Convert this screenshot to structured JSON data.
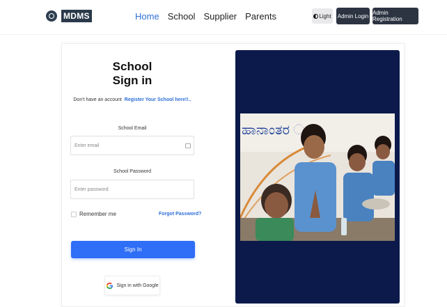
{
  "nav": {
    "brand": "MDMS",
    "links": [
      "Home",
      "School",
      "Supplier",
      "Parents"
    ],
    "active": "Home",
    "theme_label": "Light",
    "admin_login": "Admin Login",
    "admin_register": "Admin Registration"
  },
  "form": {
    "title_line1": "School",
    "title_line2": "Sign in",
    "no_account_text": "Don't have an account",
    "register_link": "Register Your School here!!..",
    "email_label": "School Email",
    "email_placeholder": "Enter email",
    "password_label": "School Password",
    "password_placeholder": "Enter password",
    "remember_me": "Remember me",
    "forgot_password": "Forgot Password?",
    "signin_button": "Sign In",
    "google_button": "Sign in with Google"
  },
  "photo": {
    "wall_text": "ಹಾನಾಂತರ ಂತ"
  },
  "colors": {
    "accent": "#2f6ef6",
    "link": "#2e6fd8",
    "nav_button": "#2c3442",
    "panel_bg": "#0b1a4a"
  },
  "icons": [
    "logo-icon",
    "theme-toggle-icon",
    "mail-icon",
    "google-icon"
  ]
}
